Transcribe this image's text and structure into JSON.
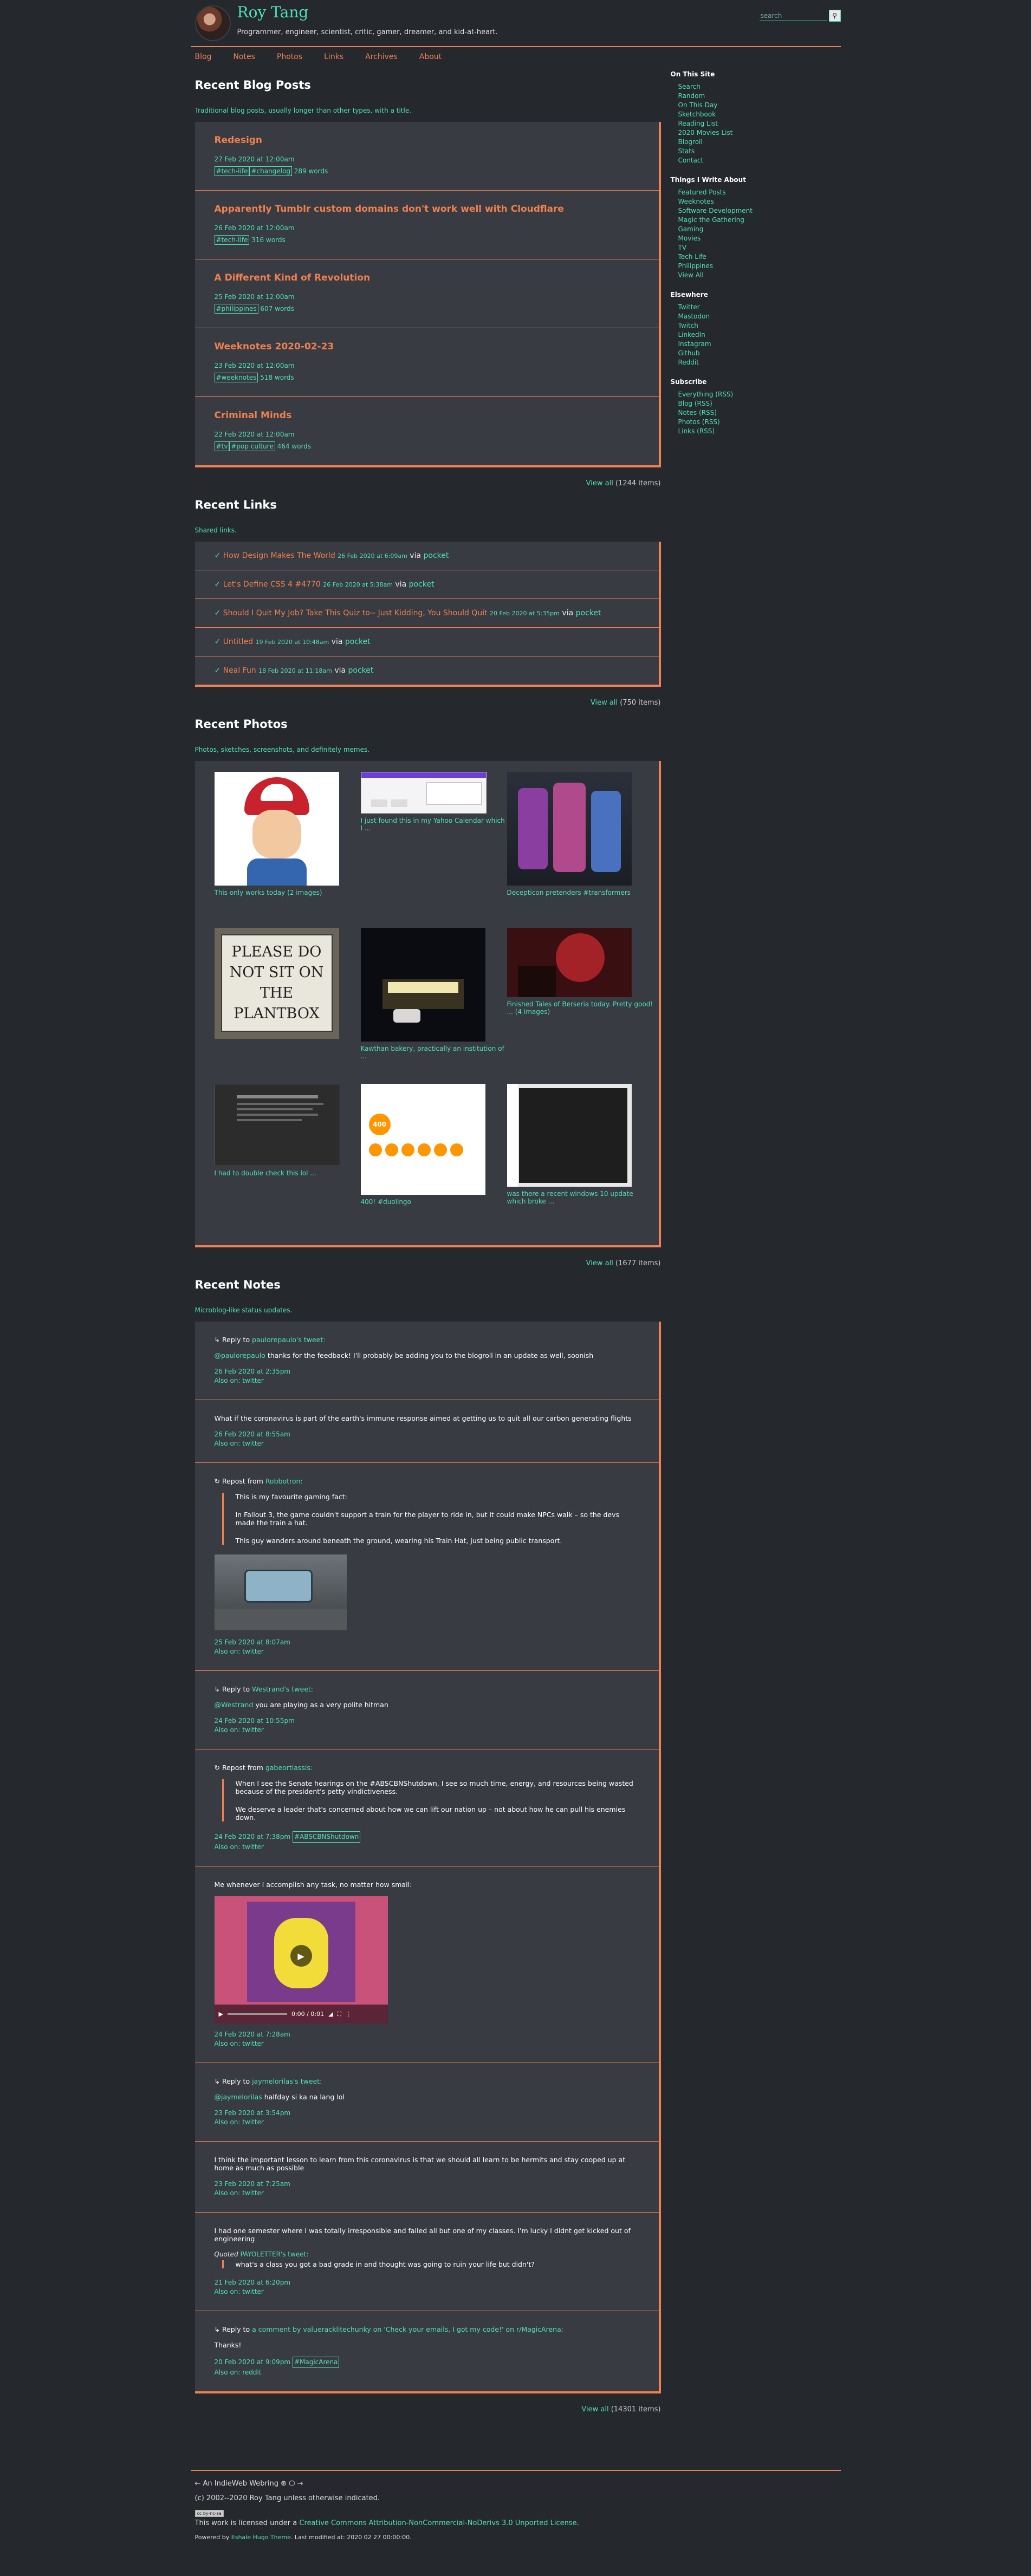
{
  "header": {
    "title": "Roy Tang",
    "tagline": "Programmer, engineer, scientist, critic, gamer, dreamer, and kid-at-heart.",
    "search_placeholder": "search",
    "search_button": "⚲"
  },
  "nav": [
    "Blog",
    "Notes",
    "Photos",
    "Links",
    "Archives",
    "About"
  ],
  "blog": {
    "heading": "Recent Blog Posts",
    "subtitle": "Traditional blog posts, usually longer than other types, with a title.",
    "posts": [
      {
        "title": "Redesign",
        "date": "27 Feb 2020 at 12:00am",
        "tags": [
          "#tech-life",
          "#changelog"
        ],
        "words": "289 words"
      },
      {
        "title": "Apparently Tumblr custom domains don't work well with Cloudflare",
        "date": "26 Feb 2020 at 12:00am",
        "tags": [
          "#tech-life"
        ],
        "words": "316 words"
      },
      {
        "title": "A Different Kind of Revolution",
        "date": "25 Feb 2020 at 12:00am",
        "tags": [
          "#philippines"
        ],
        "words": "607 words"
      },
      {
        "title": "Weeknotes 2020-02-23",
        "date": "23 Feb 2020 at 12:00am",
        "tags": [
          "#weeknotes"
        ],
        "words": "518 words"
      },
      {
        "title": "Criminal Minds",
        "date": "22 Feb 2020 at 12:00am",
        "tags": [
          "#tv",
          "#pop culture"
        ],
        "words": "464 words"
      }
    ],
    "view_all": "View all",
    "count": "(1244 items)"
  },
  "links": {
    "heading": "Recent Links",
    "subtitle": "Shared links.",
    "items": [
      {
        "title": "How Design Makes The World",
        "date": "26 Feb 2020 at 6:09am",
        "via": "via",
        "source": "pocket"
      },
      {
        "title": "Let's Define CSS 4 #4770",
        "date": "26 Feb 2020 at 5:38am",
        "via": "via",
        "source": "pocket"
      },
      {
        "title": "Should I Quit My Job? Take This Quiz to-- Just Kidding, You Should Quit",
        "date": "20 Feb 2020 at 5:35pm",
        "via": "via",
        "source": "pocket"
      },
      {
        "title": "Untitled",
        "date": "19 Feb 2020 at 10:48am",
        "via": "via",
        "source": "pocket"
      },
      {
        "title": "Neal Fun",
        "date": "18 Feb 2020 at 11:18am",
        "via": "via",
        "source": "pocket"
      }
    ],
    "view_all": "View all",
    "count": "(750 items)"
  },
  "photos": {
    "heading": "Recent Photos",
    "subtitle": "Photos, sketches, screenshots, and definitely memes.",
    "items": [
      {
        "caption": "This only works today (2 images)"
      },
      {
        "caption": "I just found this in my Yahoo Calendar which I ..."
      },
      {
        "caption": "Decepticon pretenders #transformers"
      },
      {
        "caption": ""
      },
      {
        "caption": "Kawthan bakery, practically an institution of ..."
      },
      {
        "caption": "Finished Tales of Berseria today. Pretty good! ... (4 images)"
      },
      {
        "caption": "I had to double check this lol ..."
      },
      {
        "caption": "400! #duolingo"
      },
      {
        "caption": "was there a recent windows 10 update which broke ..."
      }
    ],
    "sign_text": "PLEASE DO NOT SIT ON THE PLANTBOX",
    "duolingo_count": "400",
    "view_all": "View all",
    "count": "(1677 items)"
  },
  "notes": {
    "heading": "Recent Notes",
    "subtitle": "Microblog-like status updates.",
    "items": [
      {
        "context": "↳ Reply to",
        "context_link": "paulorepaulo's tweet:",
        "body_link": "@paulorepaulo",
        "body": "thanks for the feedback! I'll probably be adding you to the blogroll in an update as well, soonish",
        "date": "26 Feb 2020 at 2:35pm",
        "also": "Also on: twitter"
      },
      {
        "body": "What if the coronavirus is part of the earth's immune response aimed at getting us to quit all our carbon generating flights",
        "date": "26 Feb 2020 at 8:55am",
        "also": "Also on: twitter"
      },
      {
        "context": "↻ Repost from",
        "context_link": "Robbotron:",
        "quote": [
          "This is my favourite gaming fact:",
          "In Fallout 3, the game couldn't support a train for the player to ride in, but it could make NPCs walk – so the devs made the train a hat.",
          "This guy wanders around beneath the ground, wearing his Train Hat, just being public transport."
        ],
        "date": "25 Feb 2020 at 8:07am",
        "also": "Also on: twitter"
      },
      {
        "context": "↳ Reply to",
        "context_link": "Westrand's tweet:",
        "body_link": "@Westrand",
        "body": "you are playing as a very polite hitman",
        "date": "24 Feb 2020 at 10:55pm",
        "also": "Also on: twitter"
      },
      {
        "context": "↻ Repost from",
        "context_link": "gabeortiassis:",
        "quote": [
          "When I see the Senate hearings on the #ABSCBNShutdown, I see so much time, energy, and resources being wasted because of the president's petty vindictiveness.",
          "We deserve a leader that's concerned about how we can lift our nation up – not about how he can pull his enemies down."
        ],
        "date": "24 Feb 2020 at 7:38pm",
        "tag": "#ABSCBNShutdown",
        "also": "Also on: twitter"
      },
      {
        "body": "Me whenever I accomplish any task, no matter how small:",
        "video_time": "0:00 / 0:01",
        "date": "24 Feb 2020 at 7:28am",
        "also": "Also on: twitter"
      },
      {
        "context": "↳ Reply to",
        "context_link": "jaymelorilas's tweet:",
        "body_link": "@jaymelorilas",
        "body": "halfday si ka na lang lol",
        "date": "23 Feb 2020 at 3:54pm",
        "also": "Also on: twitter"
      },
      {
        "body": "I think the important lesson to learn from this coronavirus is that we should all learn to be hermits and stay cooped up at home as much as possible",
        "date": "23 Feb 2020 at 7:25am",
        "also": "Also on: twitter"
      },
      {
        "body": "I had one semester where I was totally irresponsible and failed all but one of my classes. I'm lucky I didnt get kicked out of engineering",
        "quoted_label": "Quoted",
        "quoted_link": "PAYOLETTER's tweet:",
        "quoted_text": "what's a class you got a bad grade in and thought was going to ruin your life but didn't?",
        "date": "21 Feb 2020 at 6:20pm",
        "also": "Also on: twitter"
      },
      {
        "context": "↳ Reply to",
        "context_link": "a comment by valueracklitechunky on 'Check your emails, I got my code!' on r/MagicArena:",
        "body": "Thanks!",
        "date": "20 Feb 2020 at 9:09pm",
        "tag": "#MagicArena",
        "also": "Also on: reddit"
      }
    ],
    "view_all": "View all",
    "count": "(14301 items)"
  },
  "sidebar": {
    "sections": [
      {
        "heading": "On This Site",
        "items": [
          "Search",
          "Random",
          "On This Day",
          "Sketchbook",
          "Reading List",
          "2020 Movies List",
          "Blogroll",
          "Stats",
          "Contact"
        ]
      },
      {
        "heading": "Things I Write About",
        "items": [
          "Featured Posts",
          "Weeknotes",
          "Software Development",
          "Magic the Gathering",
          "Gaming",
          "Movies",
          "TV",
          "Tech Life",
          "Philippines",
          "View All"
        ]
      },
      {
        "heading": "Elsewhere",
        "items": [
          "Twitter",
          "Mastodon",
          "Twitch",
          "LinkedIn",
          "Instagram",
          "Github",
          "Reddit"
        ]
      },
      {
        "heading": "Subscribe",
        "items": [
          "Everything (RSS)",
          "Blog (RSS)",
          "Notes (RSS)",
          "Photos (RSS)",
          "Links (RSS)"
        ]
      }
    ]
  },
  "footer": {
    "webring": "← An IndieWeb Webring ⊛ ⬡ →",
    "copyright": "(c) 2002--2020 Roy Tang unless otherwise indicated.",
    "cc_badge": "cc by-nc-sa",
    "license_prefix": "This work is licensed under a",
    "license_link": "Creative Commons Attribution-NonCommercial-NoDerivs 3.0 Unported License",
    "powered_prefix": "Powered by",
    "powered_link": "Eshale Hugo Theme",
    "last_modified": ". Last modified at: 2020 02 27 00:00:00."
  },
  "colors": {
    "accent": "#f08050",
    "link": "#4ee0b8",
    "background": "#25282d",
    "card": "#383b41"
  }
}
